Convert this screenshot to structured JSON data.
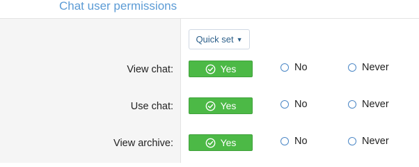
{
  "section": {
    "title": "Chat user permissions"
  },
  "quick_set": {
    "label": "Quick set",
    "caret_icon": "caret-down-icon"
  },
  "rows": [
    {
      "label": "View chat:",
      "selected": "Yes",
      "options": {
        "yes": "Yes",
        "no": "No",
        "never": "Never"
      }
    },
    {
      "label": "Use chat:",
      "selected": "Yes",
      "options": {
        "yes": "Yes",
        "no": "No",
        "never": "Never"
      }
    },
    {
      "label": "View archive:",
      "selected": "Yes",
      "options": {
        "yes": "Yes",
        "no": "No",
        "never": "Never"
      }
    }
  ],
  "colors": {
    "title": "#5b9bd5",
    "yes_bg": "#4cb946",
    "radio": "#4a86c5",
    "left_panel_bg": "#f5f5f5"
  }
}
